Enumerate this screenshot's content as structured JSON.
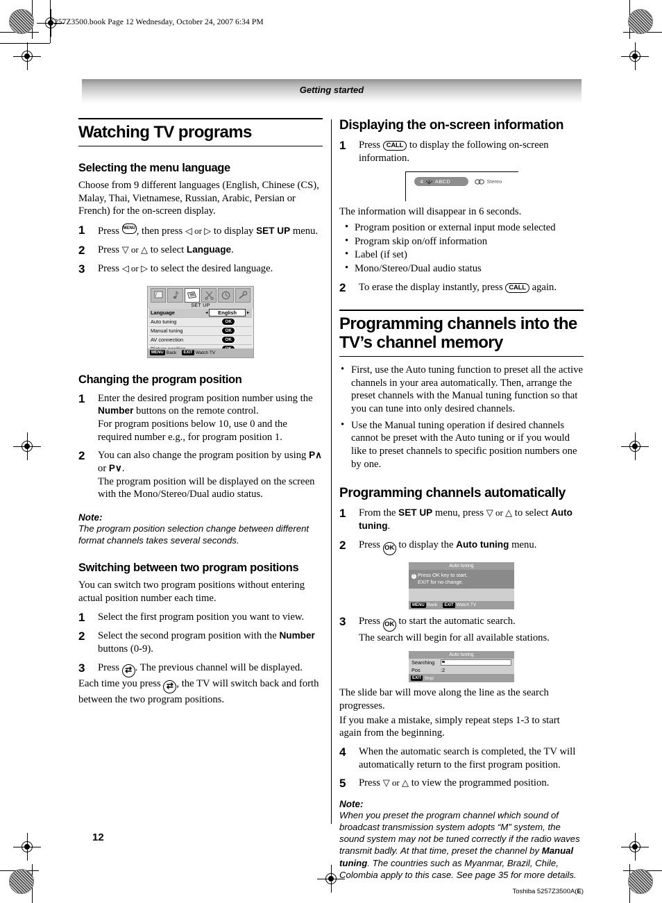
{
  "file_header": "5257Z3500.book  Page 12  Wednesday, October 24, 2007  6:34 PM",
  "running_head": "Getting started",
  "page_number": "12",
  "colophon_prefix": "Toshiba 5257Z3500A(",
  "colophon_bold": "E",
  "colophon_suffix": ")",
  "left_column": {
    "title": "Watching TV programs",
    "section_language": {
      "heading": "Selecting the menu language",
      "intro": "Choose from 9 different languages (English, Chinese (CS), Malay, Thai, Vietnamese, Russian, Arabic, Persian or French) for the on-screen display.",
      "steps": [
        {
          "n": "1",
          "pre": "Press ",
          "key": "MENU",
          "mid": ", then press ",
          "arrows": "◁ or ▷",
          "post": " to display ",
          "bold": "SET UP",
          "tail": " menu."
        },
        {
          "n": "2",
          "pre": "Press ",
          "arrows": "▽ or △",
          "post": " to select ",
          "bold": "Language",
          "tail": "."
        },
        {
          "n": "3",
          "pre": "Press ",
          "arrows": "◁ or ▷",
          "post": " to select the desired language.",
          "bold": "",
          "tail": ""
        }
      ]
    },
    "osd_setup": {
      "icons": [
        "screen-icon",
        "music-note-icon",
        "document-icon",
        "scissors-icon",
        "clock-icon",
        "wrench-icon"
      ],
      "selected_icon_index": 2,
      "title": "SET UP",
      "rows": [
        {
          "label": "Language",
          "value": "English",
          "type": "value",
          "highlight": true
        },
        {
          "label": "Auto tuning",
          "value": "OK",
          "type": "ok",
          "highlight": false
        },
        {
          "label": "Manual tuning",
          "value": "OK",
          "type": "ok",
          "highlight": false
        },
        {
          "label": "AV connection",
          "value": "OK",
          "type": "ok",
          "highlight": false
        },
        {
          "label": "Picture position",
          "value": "OK",
          "type": "ok",
          "highlight": false
        }
      ],
      "footer": [
        {
          "tag": "MENU",
          "label": "Back"
        },
        {
          "tag": "EXIT",
          "label": "Watch TV"
        }
      ]
    },
    "section_change_position": {
      "heading": "Changing the program position",
      "steps": [
        {
          "n": "1",
          "line1_pre": "Enter the desired program position number using the ",
          "line1_bold": "Number",
          "line1_post": " buttons on the remote control.",
          "line2": "For program positions below 10, use 0 and the required number e.g., for program position 1."
        },
        {
          "n": "2",
          "line1_pre": "You can also change the program position by using ",
          "line1_bold": "P∧",
          "line1_mid": " or ",
          "line1_bold2": "P∨",
          "line1_post": ".",
          "line2": "The program position will be displayed on the screen with the Mono/Stereo/Dual audio status."
        }
      ]
    },
    "note_1": {
      "heading": "Note:",
      "body": "The program position selection change between different format channels takes several seconds."
    },
    "section_switching": {
      "heading": "Switching between two program positions",
      "intro": "You can switch two program positions without entering actual position number each time.",
      "steps": [
        {
          "n": "1",
          "text": "Select the first program position you want to view."
        },
        {
          "n": "2",
          "pre": "Select the second program position with the ",
          "bold": "Number",
          "post": " buttons (0-9)."
        },
        {
          "n": "3",
          "pre": "Press ",
          "key": "swap-icon",
          "post": ". The previous channel will be displayed."
        }
      ],
      "closing_pre": "Each time you press ",
      "closing_key": "swap-icon",
      "closing_post": ", the TV will switch back and forth between the two program positions."
    }
  },
  "right_column": {
    "section_onscreen": {
      "heading": "Displaying the on-screen information",
      "step1": {
        "n": "1",
        "pre": "Press ",
        "key": "CALL",
        "post": " to display the following on-screen information."
      },
      "osd_banner": {
        "channel": "4",
        "antenna_icon": "antenna-icon",
        "label": "ABCD",
        "stereo_icon": "stereo-icon",
        "stereo_label": "Stereo"
      },
      "after_text": "The information will disappear in 6 seconds.",
      "bullets": [
        "Program position or external input mode selected",
        "Program skip on/off information",
        "Label (if set)",
        "Mono/Stereo/Dual audio status"
      ],
      "step2": {
        "n": "2",
        "pre": "To erase the display instantly, press ",
        "key": "CALL",
        "post": " again."
      }
    },
    "section_programming": {
      "title": "Programming channels into the TV’s channel memory",
      "bullets": [
        "First, use the Auto tuning function to preset all the active channels in your area automatically. Then, arrange the preset channels with the Manual tuning function so that you can tune into only desired channels.",
        "Use the Manual tuning operation if desired channels cannot be preset with the Auto tuning or if you would like to preset channels to specific position numbers one by one."
      ]
    },
    "section_auto": {
      "heading": "Programming channels automatically",
      "step1": {
        "n": "1",
        "pre": "From the ",
        "bold1": "SET UP",
        "mid": " menu, press ",
        "arrows": "▽ or △",
        "post": "  to select ",
        "bold2": "Auto tuning",
        "tail": "."
      },
      "step2": {
        "n": "2",
        "pre": "Press ",
        "key": "OK",
        "post": " to display the ",
        "bold": "Auto tuning",
        "tail": " menu."
      },
      "osd_dialog_1": {
        "title": "Auto tuning",
        "message_line1": "Press OK key to start.",
        "message_line2": "EXIT for no change.",
        "footer": [
          {
            "tag": "MENU",
            "label": "Back"
          },
          {
            "tag": "EXIT",
            "label": "Watch TV"
          }
        ]
      },
      "step3": {
        "n": "3",
        "pre": "Press ",
        "key": "OK",
        "post": " to start the automatic search.",
        "line2": "The search will begin for all available stations."
      },
      "osd_dialog_2": {
        "title": "Auto tuning",
        "searching_label": "Searching",
        "progress_percent": 4,
        "pos_label": "Pos",
        "pos_value": ":2",
        "footer": [
          {
            "tag": "EXIT",
            "label": "Stop"
          }
        ]
      },
      "after_text_line1": "The slide bar will move along the line as the search progresses.",
      "after_text_line2": "If you make a mistake, simply repeat steps 1-3 to start again from the beginning.",
      "step4": {
        "n": "4",
        "text": "When the automatic search is completed, the TV will automatically return to the first program position."
      },
      "step5": {
        "n": "5",
        "pre": "Press ",
        "arrows": "▽ or △",
        "post": " to view the programmed position."
      }
    },
    "note_2": {
      "heading": "Note:",
      "body_1": "When you preset the program channel which sound of broadcast transmission system adopts “M” system, the sound system may not be tuned correctly if the radio waves transmit badly. At that time, preset the channel by ",
      "body_bold": "Manual tuning",
      "body_2": ". The countries such as Myanmar, Brazil, Chile, Colombia apply to this case. See page 35 for more details."
    }
  }
}
